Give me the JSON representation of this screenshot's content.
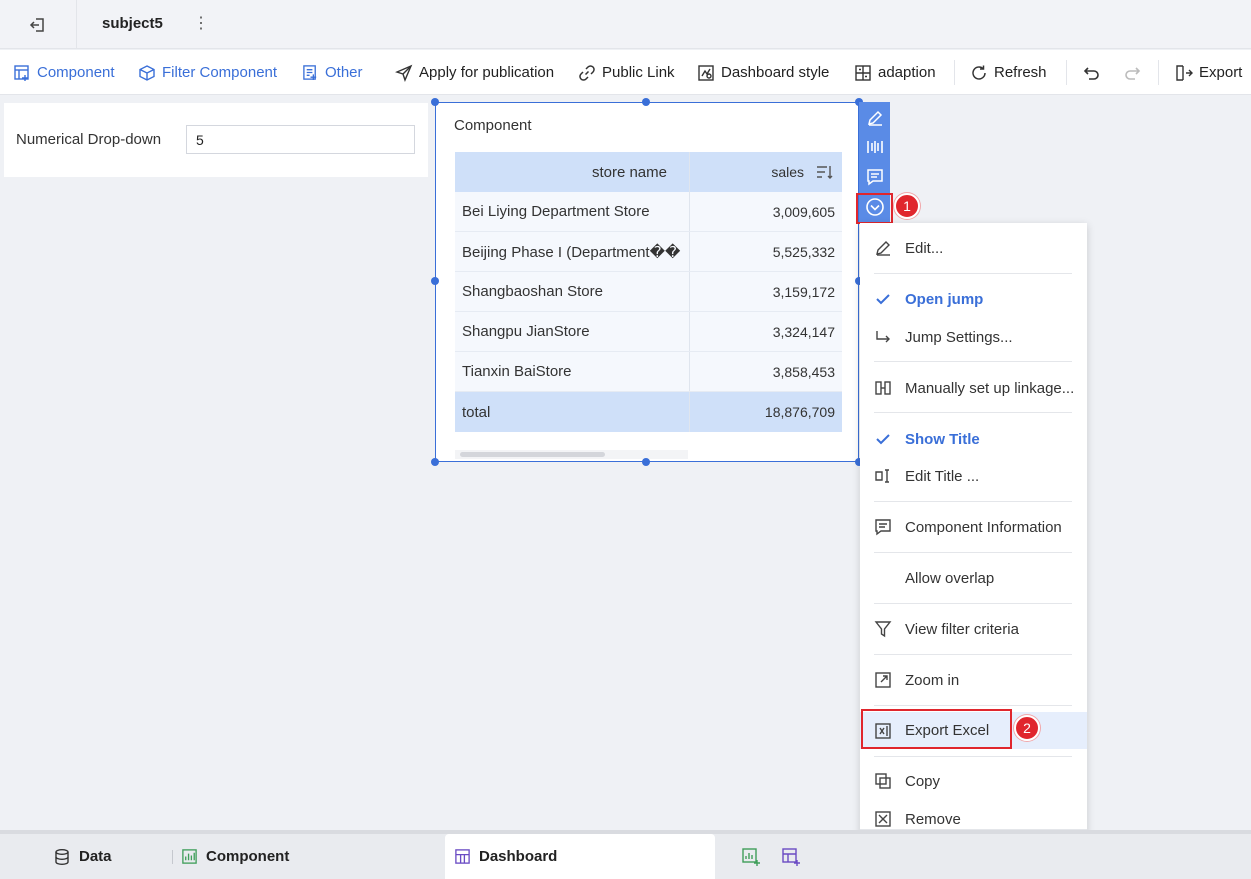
{
  "header": {
    "title": "subject5",
    "more_glyph": "⋮"
  },
  "toolbar": {
    "component": "Component",
    "filter_component": "Filter Component",
    "other": "Other",
    "apply_publication": "Apply for publication",
    "public_link": "Public Link",
    "dashboard_style": "Dashboard style",
    "adaption": "adaption",
    "refresh": "Refresh",
    "export": "Export"
  },
  "filter_widget": {
    "label": "Numerical Drop-down",
    "value": "5"
  },
  "component_widget": {
    "title": "Component",
    "columns": [
      "store name",
      "sales"
    ],
    "rows": [
      {
        "store": "Bei Liying Department Store",
        "sales": "3,009,605"
      },
      {
        "store": "Beijing Phase I (Department��",
        "sales": "5,525,332"
      },
      {
        "store": "Shangbaoshan Store",
        "sales": "3,159,172"
      },
      {
        "store": "Shangpu JianStore",
        "sales": "3,324,147"
      },
      {
        "store": "Tianxin BaiStore",
        "sales": "3,858,453"
      }
    ],
    "total": {
      "label": "total",
      "value": "18,876,709"
    }
  },
  "annotations": {
    "badge1": "1",
    "badge2": "2"
  },
  "context_menu": {
    "edit": "Edit...",
    "open_jump": "Open jump",
    "jump_settings": "Jump Settings...",
    "manual_linkage": "Manually set up linkage...",
    "show_title": "Show Title",
    "edit_title": "Edit Title ...",
    "component_information": "Component Information",
    "allow_overlap": "Allow overlap",
    "view_filter_criteria": "View filter criteria",
    "zoom_in": "Zoom in",
    "export_excel": "Export Excel",
    "copy": "Copy",
    "remove": "Remove"
  },
  "bottom_tabs": {
    "data": "Data",
    "component": "Component",
    "dashboard": "Dashboard"
  },
  "colors": {
    "accent": "#3a6fd8",
    "highlight": "#e0262d",
    "action_bar": "#5a8be6",
    "table_header": "#cfe0f9"
  }
}
